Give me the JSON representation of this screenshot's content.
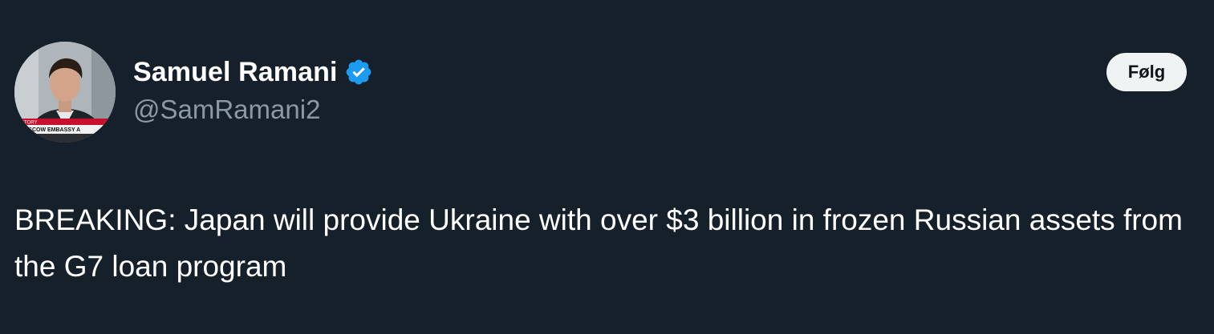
{
  "author": {
    "display_name": "Samuel Ramani",
    "handle": "@SamRamani2",
    "verified": true,
    "avatar": {
      "icon": "avatar-photo",
      "banner_line_1": "STORY",
      "banner_line_2": "MOSCOW EMBASSY A"
    }
  },
  "actions": {
    "follow_label": "Følg"
  },
  "tweet": {
    "text": "BREAKING: Japan will provide Ukraine with over $3 billion in frozen Russian assets from the G7 loan program"
  },
  "colors": {
    "background": "#15202b",
    "text_primary": "#ffffff",
    "text_secondary": "#8b98a5",
    "verified_blue": "#1d9bf0",
    "follow_bg": "#eff3f4",
    "follow_text": "#0f1419"
  }
}
